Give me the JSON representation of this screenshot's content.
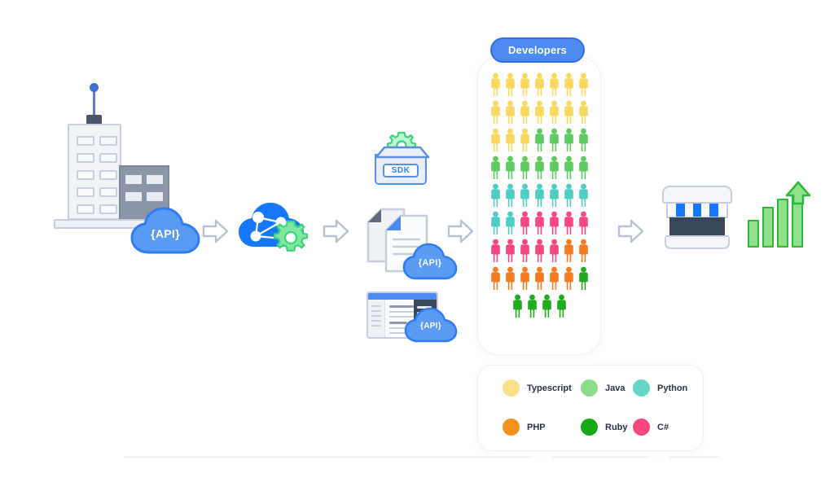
{
  "diagram": {
    "title": "API to developer ecosystem flow",
    "stages": [
      {
        "id": "enterprise",
        "name": "Enterprise building with API cloud",
        "cloud_label": "{API}"
      },
      {
        "id": "api-gateway",
        "name": "API cloud network with gear"
      },
      {
        "id": "developer-assets",
        "name": "SDK, documentation and developer portal"
      },
      {
        "id": "developers",
        "name": "Developers community"
      },
      {
        "id": "marketplace",
        "name": "Marketplace and growth"
      }
    ]
  },
  "clouds": {
    "enterprise_api": "{API}",
    "docs_api": "{API}",
    "portal_api": "{API}"
  },
  "sdk": {
    "label": "SDK"
  },
  "developers": {
    "badge": "Developers",
    "rows": [
      {
        "counts": [
          {
            "color": "#f9d85e",
            "lang": "Typescript",
            "n": 7
          }
        ]
      },
      {
        "counts": [
          {
            "color": "#f9d85e",
            "lang": "Typescript",
            "n": 7
          }
        ]
      },
      {
        "counts": [
          {
            "color": "#f9d85e",
            "lang": "Typescript",
            "n": 3
          },
          {
            "color": "#5ecb61",
            "lang": "Java",
            "n": 4
          }
        ]
      },
      {
        "counts": [
          {
            "color": "#5ecb61",
            "lang": "Java",
            "n": 7
          }
        ]
      },
      {
        "counts": [
          {
            "color": "#4ecdc4",
            "lang": "Python",
            "n": 7
          }
        ]
      },
      {
        "counts": [
          {
            "color": "#4ecdc4",
            "lang": "Python",
            "n": 2
          },
          {
            "color": "#f6477f",
            "lang": "C#",
            "n": 5
          }
        ]
      },
      {
        "counts": [
          {
            "color": "#f6477f",
            "lang": "C#",
            "n": 5
          },
          {
            "color": "#f47b20",
            "lang": "PHP",
            "n": 2
          }
        ]
      },
      {
        "counts": [
          {
            "color": "#f47b20",
            "lang": "PHP",
            "n": 6
          },
          {
            "color": "#1faa1f",
            "lang": "Ruby",
            "n": 1
          }
        ]
      },
      {
        "counts": [
          {
            "color": "#1faa1f",
            "lang": "Ruby",
            "n": 4
          }
        ]
      }
    ]
  },
  "legend": {
    "row1": [
      {
        "label": "Typescript",
        "color": "#fbe08a"
      },
      {
        "label": "Java",
        "color": "#8ddc8a"
      },
      {
        "label": "Python",
        "color": "#64d6c8"
      }
    ],
    "row2": [
      {
        "label": "PHP",
        "color": "#f4901f"
      },
      {
        "label": "Ruby",
        "color": "#16a916"
      },
      {
        "label": "C#",
        "color": "#f6477f"
      }
    ]
  },
  "colors": {
    "accent_blue": "#4d8bf0",
    "cloud_blue": "#5a9bf5",
    "api_cloud_blue": "#1677ff",
    "gear_green": "#7ee8a2",
    "outline_gray": "#c7cddb",
    "dark_slate": "#39475c",
    "bar_green": "#8fe08a",
    "bar_green_border": "#2fb83a"
  },
  "icons": {
    "arrow1": "arrow-right-icon",
    "arrow2": "arrow-right-icon",
    "arrow3": "arrow-right-icon",
    "arrow4": "arrow-right-icon",
    "building": "office-building-icon",
    "cloud_network": "cloud-network-gear-icon",
    "sdk_box": "sdk-package-icon",
    "documents": "documentation-icon",
    "portal": "developer-portal-icon",
    "store": "marketplace-storefront-icon",
    "growth": "growth-chart-icon"
  }
}
